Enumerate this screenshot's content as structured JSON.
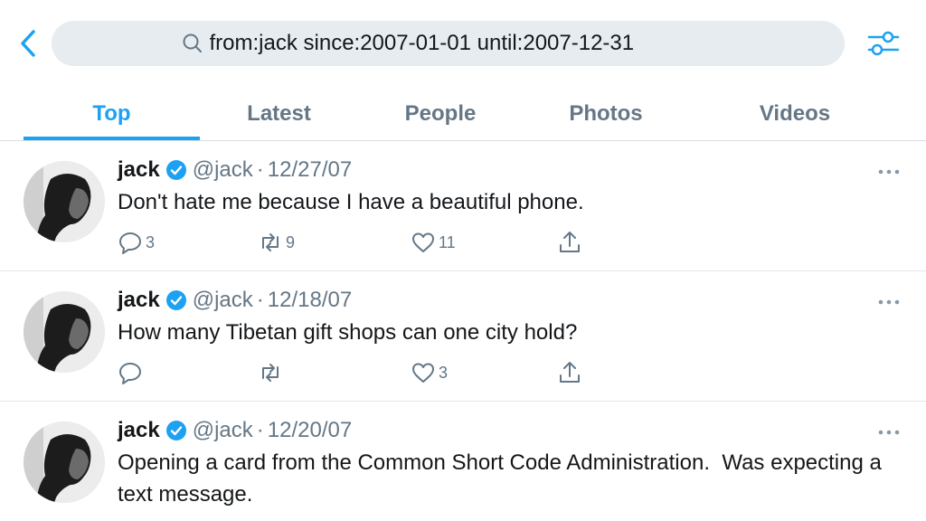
{
  "search": {
    "query": "from:jack since:2007-01-01 until:2007-12-31"
  },
  "tabs": [
    {
      "label": "Top"
    },
    {
      "label": "Latest"
    },
    {
      "label": "People"
    },
    {
      "label": "Photos"
    },
    {
      "label": "Videos"
    }
  ],
  "tweets": [
    {
      "name": "jack",
      "handle": "@jack",
      "separator": "·",
      "date": "12/27/07",
      "text": "Don't hate me because I have a beautiful phone.",
      "replies": "3",
      "retweets": "9",
      "likes": "11"
    },
    {
      "name": "jack",
      "handle": "@jack",
      "separator": "·",
      "date": "12/18/07",
      "text": "How many Tibetan gift shops can one city hold?",
      "replies": "",
      "retweets": "",
      "likes": "3"
    },
    {
      "name": "jack",
      "handle": "@jack",
      "separator": "·",
      "date": "12/20/07",
      "text": "Opening a card from the Common Short Code Administration.  Was expecting a text message."
    }
  ],
  "colors": {
    "accent": "#1da1f2",
    "secondary_text": "#657786",
    "search_bg": "#e6ecf0"
  }
}
